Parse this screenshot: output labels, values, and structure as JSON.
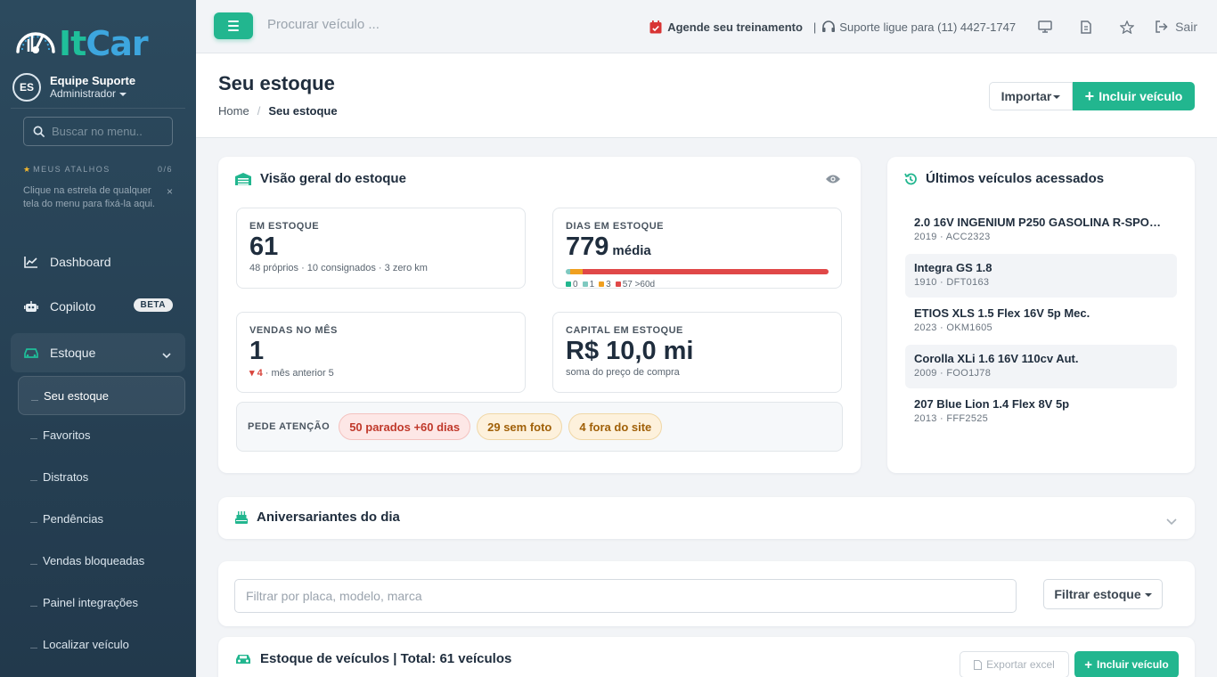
{
  "brand": {
    "logo_part1": "It",
    "logo_part2": "Car",
    "accent": "#22b68f",
    "sidebar_bg": "#2c4a5e"
  },
  "user": {
    "initials": "ES",
    "name": "Equipe Suporte",
    "role": "Administrador"
  },
  "sidebar": {
    "search_placeholder": "Buscar no menu..",
    "shortcuts_title": "MEUS ATALHOS",
    "shortcuts_count": "0/6",
    "shortcuts_hint": "Clique na estrela de qualquer tela do menu para fixá-la aqui.",
    "items": [
      {
        "label": "Dashboard",
        "icon": "chart-line-icon"
      },
      {
        "label": "Copiloto",
        "icon": "robot-icon",
        "badge": "BETA"
      },
      {
        "label": "Estoque",
        "icon": "car-icon"
      }
    ],
    "sub_items": [
      "Seu estoque",
      "Favoritos",
      "Distratos",
      "Pendências",
      "Vendas bloqueadas",
      "Painel integrações",
      "Localizar veículo"
    ]
  },
  "topbar": {
    "search_placeholder": "Procurar veículo ...",
    "training": "Agende seu treinamento",
    "support": "Suporte ligue para (11) 4427-1747",
    "logout": "Sair"
  },
  "page": {
    "title": "Seu estoque",
    "breadcrumb": [
      "Home",
      "Seu estoque"
    ],
    "import_label": "Importar",
    "include_label": "Incluir veículo"
  },
  "overview": {
    "title": "Visão geral do estoque",
    "in_stock": {
      "label": "EM ESTOQUE",
      "value": "61",
      "sub": "48 próprios · 10 consignados · 3 zero km"
    },
    "days": {
      "label": "DIAS EM ESTOQUE",
      "value": "779",
      "suffix": "média",
      "buckets": [
        {
          "label": "0",
          "count": 0,
          "color": "#22b68f"
        },
        {
          "label": "1",
          "count": 1,
          "color": "#7fc9c0"
        },
        {
          "label": "3",
          "count": 3,
          "color": "#f0a020"
        },
        {
          "label": "57 >60d",
          "count": 57,
          "color": "#e04848"
        }
      ]
    },
    "sales": {
      "label": "VENDAS NO MÊS",
      "value": "1",
      "delta": "4",
      "sub": "· mês anterior 5"
    },
    "capital": {
      "label": "CAPITAL EM ESTOQUE",
      "value": "R$ 10,0 mi",
      "sub": "soma do preço de compra"
    },
    "attention": {
      "label": "PEDE ATENÇÃO",
      "chips": [
        "50 parados +60 dias",
        "29 sem foto",
        "4 fora do site"
      ]
    }
  },
  "recent": {
    "title": "Últimos veículos acessados",
    "items": [
      {
        "name": "2.0 16V INGENIUM P250 GASOLINA R-SPORT...",
        "meta": "2019 · ACC2323"
      },
      {
        "name": "Integra GS 1.8",
        "meta": "1910 · DFT0163"
      },
      {
        "name": "ETIOS XLS 1.5 Flex 16V 5p Mec.",
        "meta": "2023 · OKM1605"
      },
      {
        "name": "Corolla XLi 1.6 16V 110cv Aut.",
        "meta": "2009 · FOO1J78"
      },
      {
        "name": "207 Blue Lion 1.4 Flex 8V 5p",
        "meta": "2013 · FFF2525"
      }
    ]
  },
  "birthdays": {
    "title": "Aniversariantes do dia"
  },
  "filter": {
    "placeholder": "Filtrar por placa, modelo, marca",
    "button": "Filtrar estoque"
  },
  "vehicles": {
    "title": "Estoque de veículos | Total: 61 veículos",
    "export_label": "Exportar excel",
    "include_label": "Incluir veículo"
  }
}
